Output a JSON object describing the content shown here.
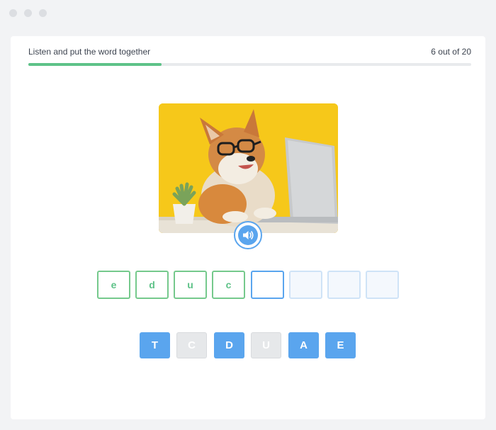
{
  "header": {
    "instruction": "Listen and put the word together",
    "counter": "6 out of 20"
  },
  "progress": {
    "current": 6,
    "total": 20,
    "fraction": 0.3,
    "color": "#5ec288"
  },
  "accent_color": "#5aa5ee",
  "audio": {
    "icon": "speaker-icon"
  },
  "answer_slots": [
    {
      "letter": "e",
      "state": "filled"
    },
    {
      "letter": "d",
      "state": "filled"
    },
    {
      "letter": "u",
      "state": "filled"
    },
    {
      "letter": "c",
      "state": "filled"
    },
    {
      "letter": "",
      "state": "active"
    },
    {
      "letter": "",
      "state": "empty"
    },
    {
      "letter": "",
      "state": "empty"
    },
    {
      "letter": "",
      "state": "empty"
    }
  ],
  "letter_tiles": [
    {
      "letter": "T",
      "state": "available"
    },
    {
      "letter": "C",
      "state": "used"
    },
    {
      "letter": "D",
      "state": "available"
    },
    {
      "letter": "U",
      "state": "used"
    },
    {
      "letter": "A",
      "state": "available"
    },
    {
      "letter": "E",
      "state": "available"
    }
  ]
}
